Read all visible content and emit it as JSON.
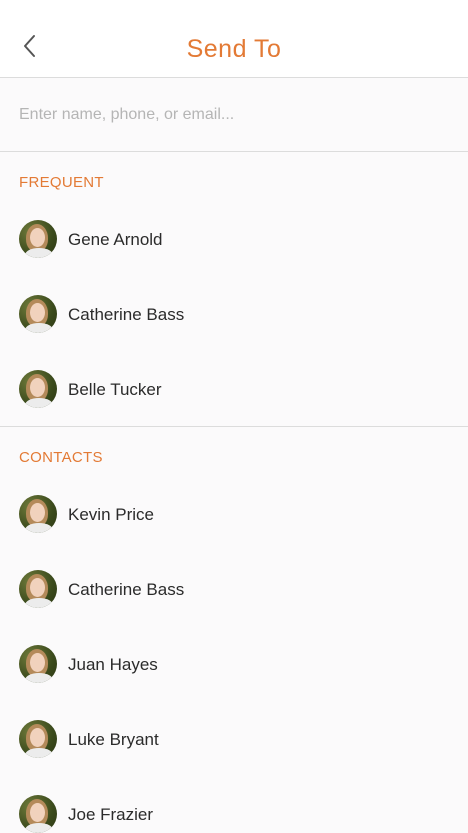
{
  "colors": {
    "accent": "#e37a35",
    "text": "#2b2b2b",
    "placeholder": "#b5b5b5",
    "divider": "#dcdcdc"
  },
  "header": {
    "title": "Send To",
    "back_icon": "chevron-left-icon"
  },
  "search": {
    "placeholder": "Enter name, phone, or email...",
    "value": ""
  },
  "frequent": {
    "label": "FREQUENT",
    "contacts": [
      {
        "name": "Gene Arnold"
      },
      {
        "name": "Catherine Bass"
      },
      {
        "name": "Belle Tucker"
      }
    ]
  },
  "contacts": {
    "label": "CONTACTS",
    "items": [
      {
        "name": "Kevin Price"
      },
      {
        "name": "Catherine Bass"
      },
      {
        "name": "Juan Hayes"
      },
      {
        "name": "Luke Bryant"
      },
      {
        "name": "Joe Frazier"
      }
    ]
  }
}
